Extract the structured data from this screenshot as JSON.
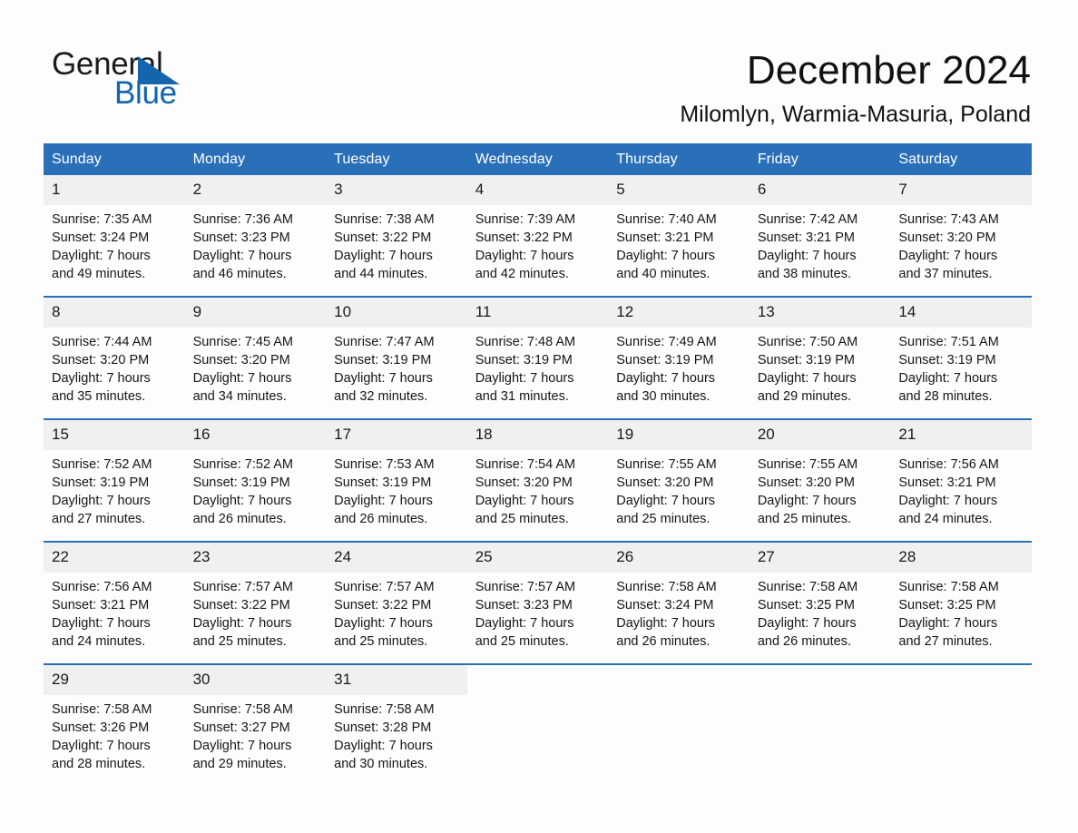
{
  "brand": {
    "name_part1": "General",
    "name_part2": "Blue",
    "accent_color": "#1565ad",
    "triangle_icon": "brand-triangle-icon"
  },
  "header": {
    "title": "December 2024",
    "location": "Milomlyn, Warmia-Masuria, Poland"
  },
  "calendar": {
    "header_bg": "#2a70b8",
    "daynum_bg": "#f0f0f0",
    "weekdays": [
      "Sunday",
      "Monday",
      "Tuesday",
      "Wednesday",
      "Thursday",
      "Friday",
      "Saturday"
    ],
    "weeks": [
      [
        {
          "day": "1",
          "sunrise": "Sunrise: 7:35 AM",
          "sunset": "Sunset: 3:24 PM",
          "daylight_line1": "Daylight: 7 hours",
          "daylight_line2": "and 49 minutes."
        },
        {
          "day": "2",
          "sunrise": "Sunrise: 7:36 AM",
          "sunset": "Sunset: 3:23 PM",
          "daylight_line1": "Daylight: 7 hours",
          "daylight_line2": "and 46 minutes."
        },
        {
          "day": "3",
          "sunrise": "Sunrise: 7:38 AM",
          "sunset": "Sunset: 3:22 PM",
          "daylight_line1": "Daylight: 7 hours",
          "daylight_line2": "and 44 minutes."
        },
        {
          "day": "4",
          "sunrise": "Sunrise: 7:39 AM",
          "sunset": "Sunset: 3:22 PM",
          "daylight_line1": "Daylight: 7 hours",
          "daylight_line2": "and 42 minutes."
        },
        {
          "day": "5",
          "sunrise": "Sunrise: 7:40 AM",
          "sunset": "Sunset: 3:21 PM",
          "daylight_line1": "Daylight: 7 hours",
          "daylight_line2": "and 40 minutes."
        },
        {
          "day": "6",
          "sunrise": "Sunrise: 7:42 AM",
          "sunset": "Sunset: 3:21 PM",
          "daylight_line1": "Daylight: 7 hours",
          "daylight_line2": "and 38 minutes."
        },
        {
          "day": "7",
          "sunrise": "Sunrise: 7:43 AM",
          "sunset": "Sunset: 3:20 PM",
          "daylight_line1": "Daylight: 7 hours",
          "daylight_line2": "and 37 minutes."
        }
      ],
      [
        {
          "day": "8",
          "sunrise": "Sunrise: 7:44 AM",
          "sunset": "Sunset: 3:20 PM",
          "daylight_line1": "Daylight: 7 hours",
          "daylight_line2": "and 35 minutes."
        },
        {
          "day": "9",
          "sunrise": "Sunrise: 7:45 AM",
          "sunset": "Sunset: 3:20 PM",
          "daylight_line1": "Daylight: 7 hours",
          "daylight_line2": "and 34 minutes."
        },
        {
          "day": "10",
          "sunrise": "Sunrise: 7:47 AM",
          "sunset": "Sunset: 3:19 PM",
          "daylight_line1": "Daylight: 7 hours",
          "daylight_line2": "and 32 minutes."
        },
        {
          "day": "11",
          "sunrise": "Sunrise: 7:48 AM",
          "sunset": "Sunset: 3:19 PM",
          "daylight_line1": "Daylight: 7 hours",
          "daylight_line2": "and 31 minutes."
        },
        {
          "day": "12",
          "sunrise": "Sunrise: 7:49 AM",
          "sunset": "Sunset: 3:19 PM",
          "daylight_line1": "Daylight: 7 hours",
          "daylight_line2": "and 30 minutes."
        },
        {
          "day": "13",
          "sunrise": "Sunrise: 7:50 AM",
          "sunset": "Sunset: 3:19 PM",
          "daylight_line1": "Daylight: 7 hours",
          "daylight_line2": "and 29 minutes."
        },
        {
          "day": "14",
          "sunrise": "Sunrise: 7:51 AM",
          "sunset": "Sunset: 3:19 PM",
          "daylight_line1": "Daylight: 7 hours",
          "daylight_line2": "and 28 minutes."
        }
      ],
      [
        {
          "day": "15",
          "sunrise": "Sunrise: 7:52 AM",
          "sunset": "Sunset: 3:19 PM",
          "daylight_line1": "Daylight: 7 hours",
          "daylight_line2": "and 27 minutes."
        },
        {
          "day": "16",
          "sunrise": "Sunrise: 7:52 AM",
          "sunset": "Sunset: 3:19 PM",
          "daylight_line1": "Daylight: 7 hours",
          "daylight_line2": "and 26 minutes."
        },
        {
          "day": "17",
          "sunrise": "Sunrise: 7:53 AM",
          "sunset": "Sunset: 3:19 PM",
          "daylight_line1": "Daylight: 7 hours",
          "daylight_line2": "and 26 minutes."
        },
        {
          "day": "18",
          "sunrise": "Sunrise: 7:54 AM",
          "sunset": "Sunset: 3:20 PM",
          "daylight_line1": "Daylight: 7 hours",
          "daylight_line2": "and 25 minutes."
        },
        {
          "day": "19",
          "sunrise": "Sunrise: 7:55 AM",
          "sunset": "Sunset: 3:20 PM",
          "daylight_line1": "Daylight: 7 hours",
          "daylight_line2": "and 25 minutes."
        },
        {
          "day": "20",
          "sunrise": "Sunrise: 7:55 AM",
          "sunset": "Sunset: 3:20 PM",
          "daylight_line1": "Daylight: 7 hours",
          "daylight_line2": "and 25 minutes."
        },
        {
          "day": "21",
          "sunrise": "Sunrise: 7:56 AM",
          "sunset": "Sunset: 3:21 PM",
          "daylight_line1": "Daylight: 7 hours",
          "daylight_line2": "and 24 minutes."
        }
      ],
      [
        {
          "day": "22",
          "sunrise": "Sunrise: 7:56 AM",
          "sunset": "Sunset: 3:21 PM",
          "daylight_line1": "Daylight: 7 hours",
          "daylight_line2": "and 24 minutes."
        },
        {
          "day": "23",
          "sunrise": "Sunrise: 7:57 AM",
          "sunset": "Sunset: 3:22 PM",
          "daylight_line1": "Daylight: 7 hours",
          "daylight_line2": "and 25 minutes."
        },
        {
          "day": "24",
          "sunrise": "Sunrise: 7:57 AM",
          "sunset": "Sunset: 3:22 PM",
          "daylight_line1": "Daylight: 7 hours",
          "daylight_line2": "and 25 minutes."
        },
        {
          "day": "25",
          "sunrise": "Sunrise: 7:57 AM",
          "sunset": "Sunset: 3:23 PM",
          "daylight_line1": "Daylight: 7 hours",
          "daylight_line2": "and 25 minutes."
        },
        {
          "day": "26",
          "sunrise": "Sunrise: 7:58 AM",
          "sunset": "Sunset: 3:24 PM",
          "daylight_line1": "Daylight: 7 hours",
          "daylight_line2": "and 26 minutes."
        },
        {
          "day": "27",
          "sunrise": "Sunrise: 7:58 AM",
          "sunset": "Sunset: 3:25 PM",
          "daylight_line1": "Daylight: 7 hours",
          "daylight_line2": "and 26 minutes."
        },
        {
          "day": "28",
          "sunrise": "Sunrise: 7:58 AM",
          "sunset": "Sunset: 3:25 PM",
          "daylight_line1": "Daylight: 7 hours",
          "daylight_line2": "and 27 minutes."
        }
      ],
      [
        {
          "day": "29",
          "sunrise": "Sunrise: 7:58 AM",
          "sunset": "Sunset: 3:26 PM",
          "daylight_line1": "Daylight: 7 hours",
          "daylight_line2": "and 28 minutes."
        },
        {
          "day": "30",
          "sunrise": "Sunrise: 7:58 AM",
          "sunset": "Sunset: 3:27 PM",
          "daylight_line1": "Daylight: 7 hours",
          "daylight_line2": "and 29 minutes."
        },
        {
          "day": "31",
          "sunrise": "Sunrise: 7:58 AM",
          "sunset": "Sunset: 3:28 PM",
          "daylight_line1": "Daylight: 7 hours",
          "daylight_line2": "and 30 minutes."
        },
        {
          "day": "",
          "sunrise": "",
          "sunset": "",
          "daylight_line1": "",
          "daylight_line2": ""
        },
        {
          "day": "",
          "sunrise": "",
          "sunset": "",
          "daylight_line1": "",
          "daylight_line2": ""
        },
        {
          "day": "",
          "sunrise": "",
          "sunset": "",
          "daylight_line1": "",
          "daylight_line2": ""
        },
        {
          "day": "",
          "sunrise": "",
          "sunset": "",
          "daylight_line1": "",
          "daylight_line2": ""
        }
      ]
    ]
  }
}
